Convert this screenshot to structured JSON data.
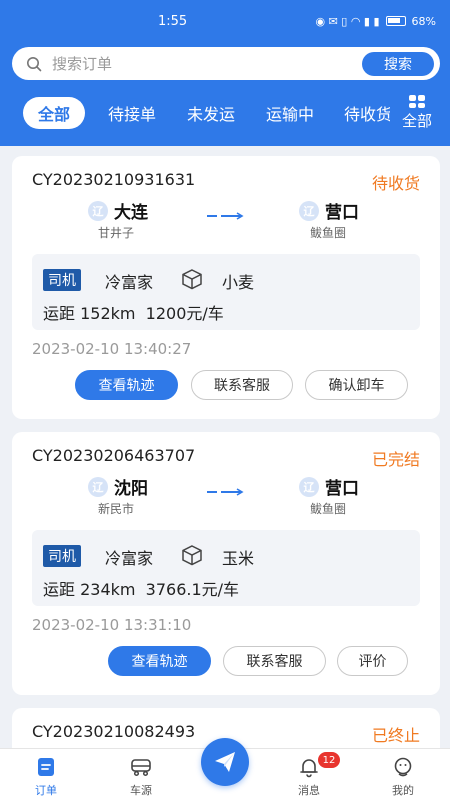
{
  "status_bar": {
    "time": "1:55",
    "battery": "68%"
  },
  "search": {
    "placeholder": "搜索订单",
    "button_label": "搜索"
  },
  "tabs": [
    {
      "label": "全部",
      "active": true
    },
    {
      "label": "待接单"
    },
    {
      "label": "未发运"
    },
    {
      "label": "运输中"
    },
    {
      "label": "待收货"
    }
  ],
  "all_button_label": "全部",
  "orders": [
    {
      "order_no": "CY20230210931631",
      "status": "待收货",
      "from": {
        "province": "辽",
        "city": "大连",
        "district": "甘井子"
      },
      "to": {
        "province": "辽",
        "city": "营口",
        "district": "鲅鱼圈"
      },
      "driver_tag": "司机",
      "driver_name": "冷富家",
      "cargo": "小麦",
      "distance": "运距 152km  1200元/车",
      "time": "2023-02-10 13:40:27",
      "buttons": [
        "查看轨迹",
        "联系客服",
        "确认卸车"
      ]
    },
    {
      "order_no": "CY20230206463707",
      "status": "已完结",
      "from": {
        "province": "辽",
        "city": "沈阳",
        "district": "新民市"
      },
      "to": {
        "province": "辽",
        "city": "营口",
        "district": "鲅鱼圈"
      },
      "driver_tag": "司机",
      "driver_name": "冷富家",
      "cargo": "玉米",
      "distance": "运距 234km  3766.1元/车",
      "time": "2023-02-10 13:31:10",
      "buttons": [
        "查看轨迹",
        "联系客服",
        "评价"
      ]
    },
    {
      "order_no": "CY20230210082493",
      "status": "已终止"
    }
  ],
  "nav": {
    "orders": "订单",
    "vehicles": "车源",
    "messages": "消息",
    "mine": "我的",
    "message_badge": "12"
  },
  "colors": {
    "primary": "#2f79e8",
    "status_orange": "#f07a22",
    "badge_red": "#e8342e"
  }
}
